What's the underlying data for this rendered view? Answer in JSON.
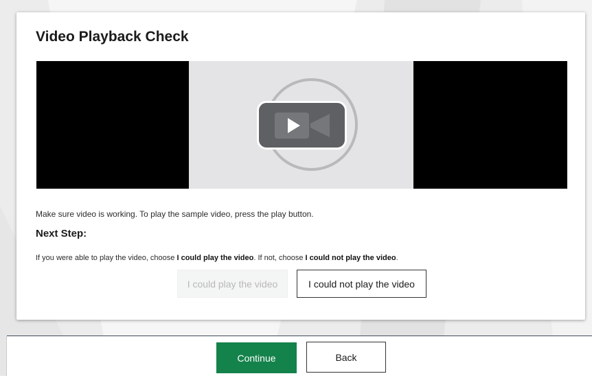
{
  "card": {
    "title": "Video Playback Check",
    "video": {
      "play_icon": "video-camera-play-icon"
    },
    "instructions": "Make sure video is working. To play the sample video, press the play button.",
    "next_step_heading": "Next Step:",
    "choose_text": {
      "part1": "If you were able to play the video, choose ",
      "bold1": "I could play the video",
      "part2": ". If not, choose ",
      "bold2": "I could not play the video",
      "part3": "."
    },
    "buttons": {
      "could_play": "I could play the video",
      "could_not_play": "I could not play the video"
    }
  },
  "footer": {
    "continue_label": "Continue",
    "back_label": "Back"
  },
  "colors": {
    "primary": "#14824b",
    "video_bg": "#000000",
    "poster_bg": "#e4e4e6",
    "play_button_bg": "#5e6064",
    "footer_border": "#3d4a5a"
  }
}
